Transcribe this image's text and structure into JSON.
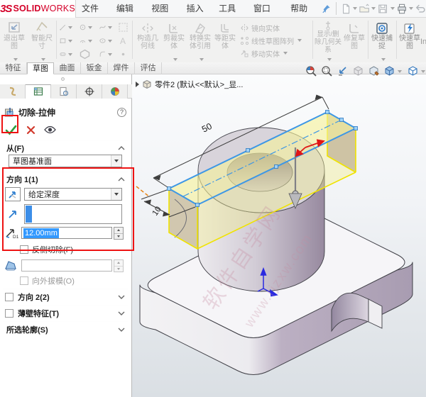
{
  "window": {
    "logo_3s": "3S",
    "logo_solid": "SOLID",
    "logo_works": "WORKS"
  },
  "menubar": {
    "items": [
      "文件(F)",
      "编辑(E)",
      "视图(V)",
      "插入(I)",
      "工具(T)",
      "窗口(W)",
      "帮助(H)"
    ]
  },
  "quick_access": {
    "icons": [
      "new-document",
      "open",
      "save",
      "print",
      "undo"
    ]
  },
  "ribbon": {
    "exit_sketch": "退出草图",
    "smart_dimension": "智能尺寸",
    "construction_geometry": "构造几何线",
    "trim_entities": "剪裁实体",
    "convert_entities": "转换实体引用",
    "offset_entities": "等距实体",
    "mirror_entities": "镜向实体",
    "linear_sketch_pattern": "线性草图阵列",
    "move_entities": "移动实体",
    "display_delete_relations": "显示/删除几何关系",
    "repair_sketch": "修复草图",
    "quick_snaps": "快速捕捉",
    "rapid_sketch": "快速草图",
    "instant_clipped": "In"
  },
  "tabs": {
    "items": [
      "特征",
      "草图",
      "曲面",
      "钣金",
      "焊件",
      "评估"
    ],
    "active": "草图"
  },
  "property_panel": {
    "title": "切除-拉伸",
    "help": "?",
    "from": {
      "label": "从(F)",
      "value": "草图基准面"
    },
    "direction1": {
      "label": "方向 1(1)",
      "end_condition": "给定深度",
      "depth_value": "12.00mm",
      "flip_side_label": "反侧切除(F)",
      "draft_outward_label": "向外拔模(O)"
    },
    "direction2_label": "方向 2(2)",
    "thin_feature_label": "薄壁特征(T)",
    "selected_contours_label": "所选轮廓(S)",
    "tab_icons": [
      "feature-manager",
      "property-manager",
      "configuration-manager",
      "dimxpert-manager",
      "display-manager"
    ]
  },
  "viewport": {
    "tree_item": "零件2 (默认<<默认>_显...",
    "dimensions": {
      "length": "50",
      "width": "10"
    },
    "watermark_line1": "软件自学网",
    "watermark_line2": "www.rjzxw.com"
  },
  "colors": {
    "annotation_red": "#ee1313",
    "selection_blue": "#3399ff",
    "sketch_blue": "#3d97e6",
    "preview_yellow": "#f4ee8e",
    "edge_yellow": "#f0e300",
    "logo_red": "#d40029"
  }
}
